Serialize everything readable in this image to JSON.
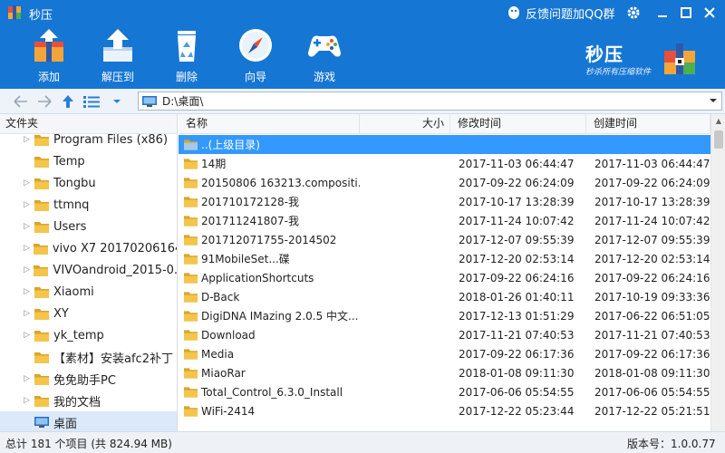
{
  "app": {
    "title": "秒压",
    "feedback": "反馈问题加QQ群"
  },
  "toolbar": [
    {
      "label": "添加",
      "icon": "add-archive-icon"
    },
    {
      "label": "解压到",
      "icon": "extract-icon"
    },
    {
      "label": "删除",
      "icon": "recycle-bin-icon"
    },
    {
      "label": "向导",
      "icon": "compass-icon"
    },
    {
      "label": "游戏",
      "icon": "gamepad-icon"
    }
  ],
  "brand": {
    "name": "秒压",
    "slogan": "秒杀所有压缩软件"
  },
  "address": {
    "path": "D:\\桌面\\"
  },
  "tree": {
    "header": "文件夹",
    "items": [
      {
        "label": "Program Files (x86)",
        "expandable": true
      },
      {
        "label": "Temp",
        "expandable": false
      },
      {
        "label": "Tongbu",
        "expandable": true
      },
      {
        "label": "ttmnq",
        "expandable": true
      },
      {
        "label": "Users",
        "expandable": true
      },
      {
        "label": "vivo X7 20170206164...",
        "expandable": true
      },
      {
        "label": "VIVOandroid_2015-0...",
        "expandable": true
      },
      {
        "label": "Xiaomi",
        "expandable": true
      },
      {
        "label": "XY",
        "expandable": true
      },
      {
        "label": "yk_temp",
        "expandable": true
      },
      {
        "label": "【素材】安装afc2补丁",
        "expandable": false
      },
      {
        "label": "免免助手PC",
        "expandable": true
      },
      {
        "label": "我的文档",
        "expandable": true
      },
      {
        "label": "桌面",
        "expandable": false,
        "selected": true
      }
    ]
  },
  "list": {
    "columns": {
      "name": "名称",
      "size": "大小",
      "mtime": "修改时间",
      "ctime": "创建时间"
    },
    "rows": [
      {
        "name": "..(上级目录)",
        "mtime": "",
        "ctime": "",
        "selected": true
      },
      {
        "name": "14期",
        "mtime": "2017-11-03 06:44:47",
        "ctime": "2017-11-03 06:44:47"
      },
      {
        "name": "20150806 163213.compositi...",
        "mtime": "2017-09-22 06:24:09",
        "ctime": "2017-09-22 06:24:09"
      },
      {
        "name": "201710172128-我",
        "mtime": "2017-10-17 13:28:39",
        "ctime": "2017-10-17 13:28:39"
      },
      {
        "name": "201711241807-我",
        "mtime": "2017-11-24 10:07:42",
        "ctime": "2017-11-24 10:07:42"
      },
      {
        "name": "201712071755-2014502",
        "mtime": "2017-12-07 09:55:39",
        "ctime": "2017-12-07 09:55:39"
      },
      {
        "name": "91MobileSet...碟",
        "mtime": "2017-12-20 02:53:14",
        "ctime": "2017-12-20 02:53:14"
      },
      {
        "name": "ApplicationShortcuts",
        "mtime": "2017-09-22 06:24:16",
        "ctime": "2017-09-22 06:24:16"
      },
      {
        "name": "D-Back",
        "mtime": "2018-01-26 01:40:11",
        "ctime": "2017-10-19 09:33:36"
      },
      {
        "name": "DigiDNA IMazing 2.0.5 中文...",
        "mtime": "2017-12-13 01:51:29",
        "ctime": "2017-06-22 06:51:05"
      },
      {
        "name": "Download",
        "mtime": "2017-11-21 07:40:53",
        "ctime": "2017-11-21 07:40:53"
      },
      {
        "name": "Media",
        "mtime": "2017-09-22 06:17:36",
        "ctime": "2017-09-22 06:17:36"
      },
      {
        "name": "MiaoRar",
        "mtime": "2018-01-08 09:11:30",
        "ctime": "2018-01-08 09:11:30"
      },
      {
        "name": "Total_Control_6.3.0_Install",
        "mtime": "2017-06-06 05:54:55",
        "ctime": "2017-06-06 05:54:55"
      },
      {
        "name": "WiFi-2414",
        "mtime": "2017-12-22 05:23:44",
        "ctime": "2017-12-22 05:21:51"
      }
    ]
  },
  "status": {
    "count": "总计 181 个项目 (共 824.94 MB)",
    "version": "版本号：1.0.0.77"
  },
  "colors": {
    "toolbar_bg": "#1676d4",
    "selection": "#3399ff",
    "folder": "#f3c54a"
  }
}
